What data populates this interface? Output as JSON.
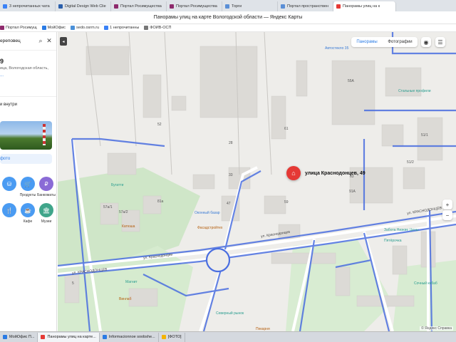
{
  "browser_tabs": [
    {
      "label": "3 непрочитанных чата",
      "color": "#3b82f6"
    },
    {
      "label": "Digital Design Web Clie",
      "color": "#2b5fab"
    },
    {
      "label": "Портал Росимущества",
      "color": "#8e2a6c"
    },
    {
      "label": "Портал Росимущества",
      "color": "#8e2a6c"
    },
    {
      "label": "Торги",
      "color": "#5b8fd6"
    },
    {
      "label": "Портал пространствен",
      "color": "#5b8fd6"
    },
    {
      "label": "Панорамы улиц на к",
      "color": "#e53935"
    }
  ],
  "window_title": "Панорамы улиц на карте Вологодской области — Яндекс Карты",
  "bookmarks": [
    {
      "label": "Портал Росимущ",
      "color": "#8e2a6c"
    },
    {
      "label": "МойОфис",
      "color": "#2a7be4"
    },
    {
      "label": "sedo.osrm.ru",
      "color": "#4a90d9"
    },
    {
      "label": "1 непрочитанны",
      "color": "#3b82f6"
    },
    {
      "label": "ФОИВ-ОСП",
      "color": "#777777"
    }
  ],
  "sidebar": {
    "search_value": "ереповец",
    "address_number": "9",
    "address_sub": "ица, Вологодская область,",
    "more_link": "...",
    "inside_label": "и внутри",
    "photo_button": "фото",
    "categories": [
      {
        "label": "",
        "icon": "cart-icon",
        "glyph": "⛁",
        "color": "#4a9bf2"
      },
      {
        "label": "Продукты",
        "icon": "shopping-basket-icon",
        "glyph": "🛒",
        "color": "#4a9bf2"
      },
      {
        "label": "Банкоматы",
        "icon": "currency-icon",
        "glyph": "₽",
        "color": "#8a6bd6"
      },
      {
        "label": "",
        "icon": "restaurant-icon",
        "glyph": "🍴",
        "color": "#4a9bf2"
      },
      {
        "label": "Кафе",
        "icon": "coffee-icon",
        "glyph": "☕",
        "color": "#4a9bf2"
      },
      {
        "label": "Музеи",
        "icon": "museum-icon",
        "glyph": "🏛",
        "color": "#3fa58a"
      }
    ]
  },
  "map": {
    "panorama_tabs": [
      "Панорамы",
      "Фотографии"
    ],
    "pin_label": "улица Краснодонцев, 49",
    "street_labels": [
      "ул. Краснодонцев",
      "ул. КРАСНОДОНЦЕВ",
      "ул. Краснодонцев",
      "ул. КРАСНОДОНЦЕВ"
    ],
    "poi_labels": [
      "Автостекло 35",
      "Стальные профили",
      "Бугатти",
      "Фасадстройтех",
      "Оконный базар",
      "Пятёрочка",
      "Забота Низкие Цены",
      "Магнит",
      "Винлаб",
      "Северный рынок",
      "Пекарня",
      "Сочный кебаб",
      "Катюша",
      "55A",
      "61",
      "91A",
      "51/1",
      "51/2",
      "59",
      "47",
      "57а/1",
      "57а/2",
      "28",
      "52",
      "81а",
      "33",
      "63",
      "5"
    ],
    "copyright": "© Яндекс  Справка"
  },
  "taskbar": [
    {
      "label": "МойОфис П...",
      "color": "#2a7be4"
    },
    {
      "label": "Панорамы улиц на карте...",
      "color": "#e53935"
    },
    {
      "label": "Informacionnoe soobshe...",
      "color": "#2a7be4"
    },
    {
      "label": "[ФОТО]",
      "color": "#f4b400"
    }
  ]
}
